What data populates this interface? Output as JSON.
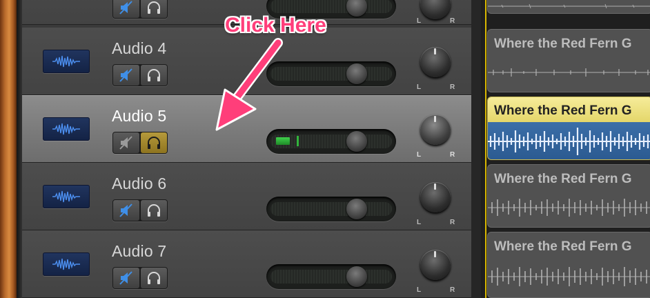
{
  "tracks": [
    {
      "name": "",
      "selected": false,
      "solo": false
    },
    {
      "name": "Audio 4",
      "selected": false,
      "solo": false
    },
    {
      "name": "Audio 5",
      "selected": true,
      "solo": true
    },
    {
      "name": "Audio 6",
      "selected": false,
      "solo": false
    },
    {
      "name": "Audio 7",
      "selected": false,
      "solo": false
    }
  ],
  "knob_labels": {
    "left": "L",
    "right": "R"
  },
  "regions": [
    {
      "title": "",
      "selected": false
    },
    {
      "title": "Where the Red Fern G",
      "selected": false
    },
    {
      "title": "Where the Red Fern G",
      "selected": true
    },
    {
      "title": "Where the Red Fern G",
      "selected": false
    },
    {
      "title": "Where the Red Fern G",
      "selected": false
    }
  ],
  "annotation": {
    "text": "Click Here"
  },
  "colors": {
    "accent_pink": "#ff3e7a",
    "solo_active": "#b69a3b",
    "mute_icon": "#3f8fe8",
    "playhead": "#d9b800",
    "level_meter": "#3fd24c"
  },
  "icons": {
    "track_icon": "audio-waveform-icon",
    "mute": "speaker-mute-icon",
    "solo": "headphones-icon",
    "pan": "pan-knob"
  }
}
